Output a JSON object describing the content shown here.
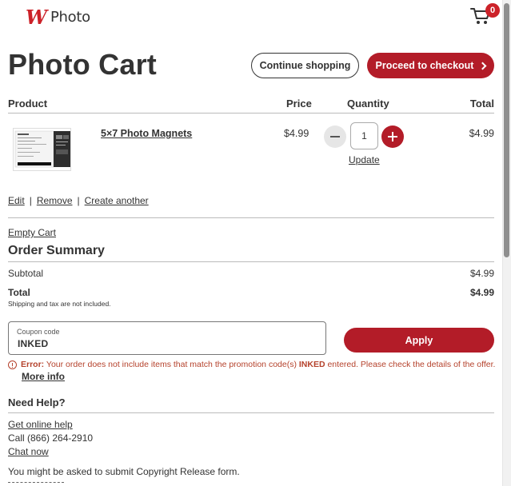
{
  "brand": {
    "logo_mark": "W",
    "logo_text": "Photo",
    "accent": "#b31c28"
  },
  "header": {
    "cart_count": "0",
    "cart_icon": "shopping-cart-icon"
  },
  "page": {
    "title": "Photo Cart",
    "continue_label": "Continue shopping",
    "checkout_label": "Proceed to checkout"
  },
  "table": {
    "headers": {
      "product": "Product",
      "price": "Price",
      "quantity": "Quantity",
      "total": "Total"
    },
    "rows": [
      {
        "name": "5×7 Photo Magnets",
        "price": "$4.99",
        "quantity": "1",
        "total": "$4.99",
        "update_label": "Update"
      }
    ]
  },
  "row_actions": {
    "edit": "Edit",
    "remove": "Remove",
    "create_another": "Create another",
    "separator": "|"
  },
  "empty_cart": "Empty Cart",
  "summary": {
    "title": "Order Summary",
    "subtotal_label": "Subtotal",
    "subtotal_value": "$4.99",
    "total_label": "Total",
    "total_value": "$4.99",
    "note": "Shipping and tax are not included."
  },
  "coupon": {
    "label": "Coupon code",
    "value": "INKED",
    "apply_label": "Apply"
  },
  "error": {
    "prefix": "Error:",
    "text_before": "Your order does not include items that match the promotion code(s)",
    "code": "INKED",
    "text_after": "entered. Please check the details of the offer.",
    "more_info": "More info",
    "color": "#b5422c"
  },
  "help": {
    "title": "Need Help?",
    "online": "Get online help",
    "call": "Call (866) 264-2910",
    "chat": "Chat now",
    "copyright": "You might be asked to submit Copyright Release form."
  }
}
